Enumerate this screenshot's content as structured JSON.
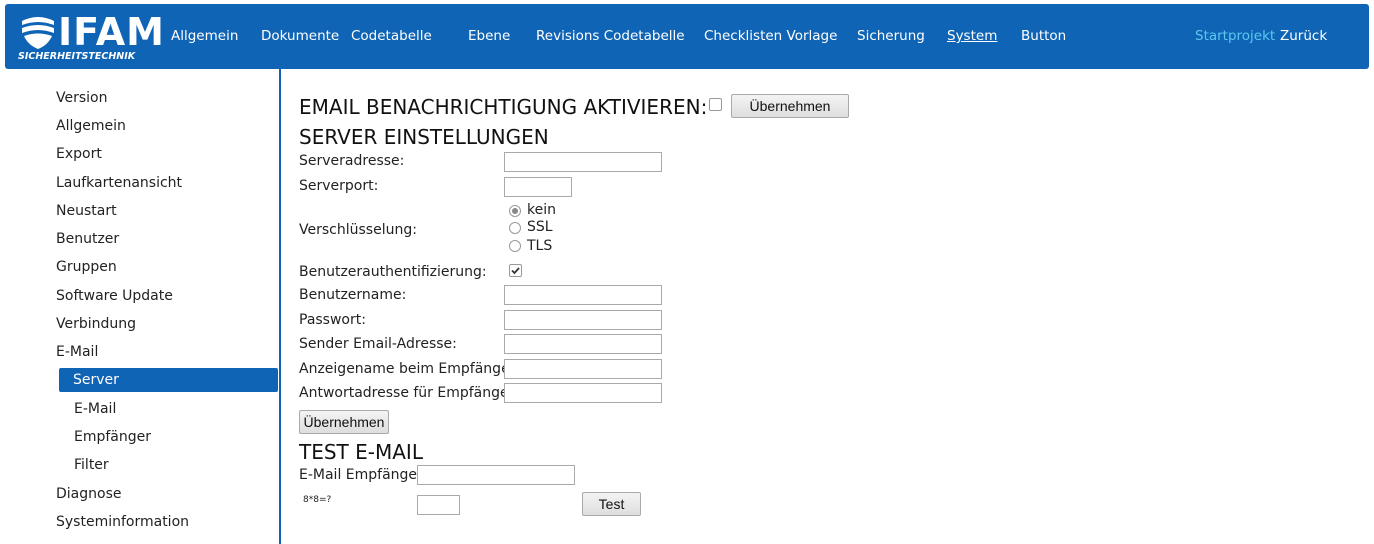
{
  "logo": {
    "title": "IFAM",
    "subtitle": "SICHERHEITSTECHNIK"
  },
  "nav": {
    "items": [
      "Allgemein",
      "Dokumente",
      "Codetabelle",
      "Ebene",
      "Revisions Codetabelle",
      "Checklisten Vorlage",
      "Sicherung",
      "System",
      "Button"
    ],
    "active": "System",
    "right": [
      "Startprojekt",
      "Zurück"
    ]
  },
  "sidebar": {
    "items": [
      "Version",
      "Allgemein",
      "Export",
      "Laufkartenansicht",
      "Neustart",
      "Benutzer",
      "Gruppen",
      "Software Update",
      "Verbindung",
      "E-Mail"
    ],
    "sub": [
      "Server",
      "E-Mail",
      "Empfänger",
      "Filter"
    ],
    "selected": "Server",
    "after": [
      "Diagnose",
      "Systeminformation"
    ]
  },
  "main": {
    "email_heading": "EMAIL BENACHRICHTIGUNG AKTIVIEREN:",
    "apply_label": "Übernehmen",
    "server_heading": "SERVER EINSTELLUNGEN",
    "fields": {
      "serveradresse": "Serveradresse:",
      "serverport": "Serverport:",
      "verschluesselung": "Verschlüsselung:",
      "benutzerauth": "Benutzerauthentifizierung:",
      "benutzername": "Benutzername:",
      "passwort": "Passwort:",
      "sender": "Sender Email-Adresse:",
      "anzeigename": "Anzeigename beim Empfänger:",
      "antwort": "Antwortadresse für Empfänger:"
    },
    "encryption_options": [
      "kein",
      "SSL",
      "TLS"
    ],
    "encryption_selected": "kein",
    "submit_label": "Übernehmen",
    "test_heading": "TEST E-MAIL",
    "test_recipient_label": "E-Mail Empfänger",
    "captcha": "8*8=?",
    "test_button": "Test"
  }
}
